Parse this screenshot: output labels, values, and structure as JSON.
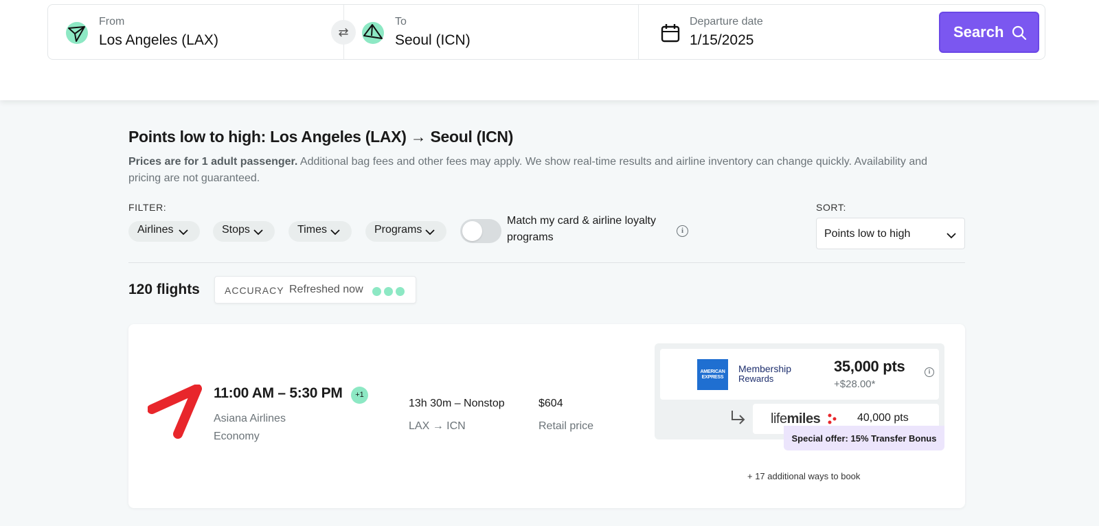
{
  "search": {
    "from_label": "From",
    "from_value": "Los Angeles (LAX)",
    "to_label": "To",
    "to_value": "Seoul (ICN)",
    "date_label": "Departure date",
    "date_value": "1/15/2025",
    "button_label": "Search"
  },
  "results": {
    "title": "Points low to high: Los Angeles (LAX) → Seoul (ICN)",
    "disclaimer_bold": "Prices are for 1 adult passenger.",
    "disclaimer_rest": " Additional bag fees and other fees may apply. We show real-time results and airline inventory can change quickly. Availability and pricing are not guaranteed.",
    "filter_label": "FILTER:",
    "filters": [
      "Airlines",
      "Stops",
      "Times",
      "Programs"
    ],
    "toggle_label": "Match my card & airline loyalty programs",
    "toggle_on": false,
    "sort_label": "SORT:",
    "sort_value": "Points low to high",
    "count": "120 flights",
    "accuracy_label": "ACCURACY",
    "accuracy_value": "Refreshed now",
    "accuracy_color": "#8de8c4"
  },
  "flight": {
    "times": "11:00 AM – 5:30 PM",
    "day_offset": "+1",
    "airline": "Asiana Airlines",
    "cabin": "Economy",
    "duration": "13h 30m – Nonstop",
    "route": "LAX → ICN",
    "price": "$604",
    "price_label": "Retail price",
    "program_logo_text": "AMERICAN EXPRESS",
    "program_name_1": "Membership",
    "program_name_2": "Rewards",
    "points": "35,000 pts",
    "fees": "+$28.00*",
    "partner_logo_light": "life",
    "partner_logo_bold": "miles",
    "partner_points": "40,000 pts",
    "offer": "Special offer: 15% Transfer Bonus",
    "more_ways": "+ 17 additional ways to book"
  },
  "colors": {
    "accent": "#7b57f0",
    "mint": "#8de8c4",
    "airline_red": "#e8262b",
    "amex_blue": "#1f6fd1"
  }
}
